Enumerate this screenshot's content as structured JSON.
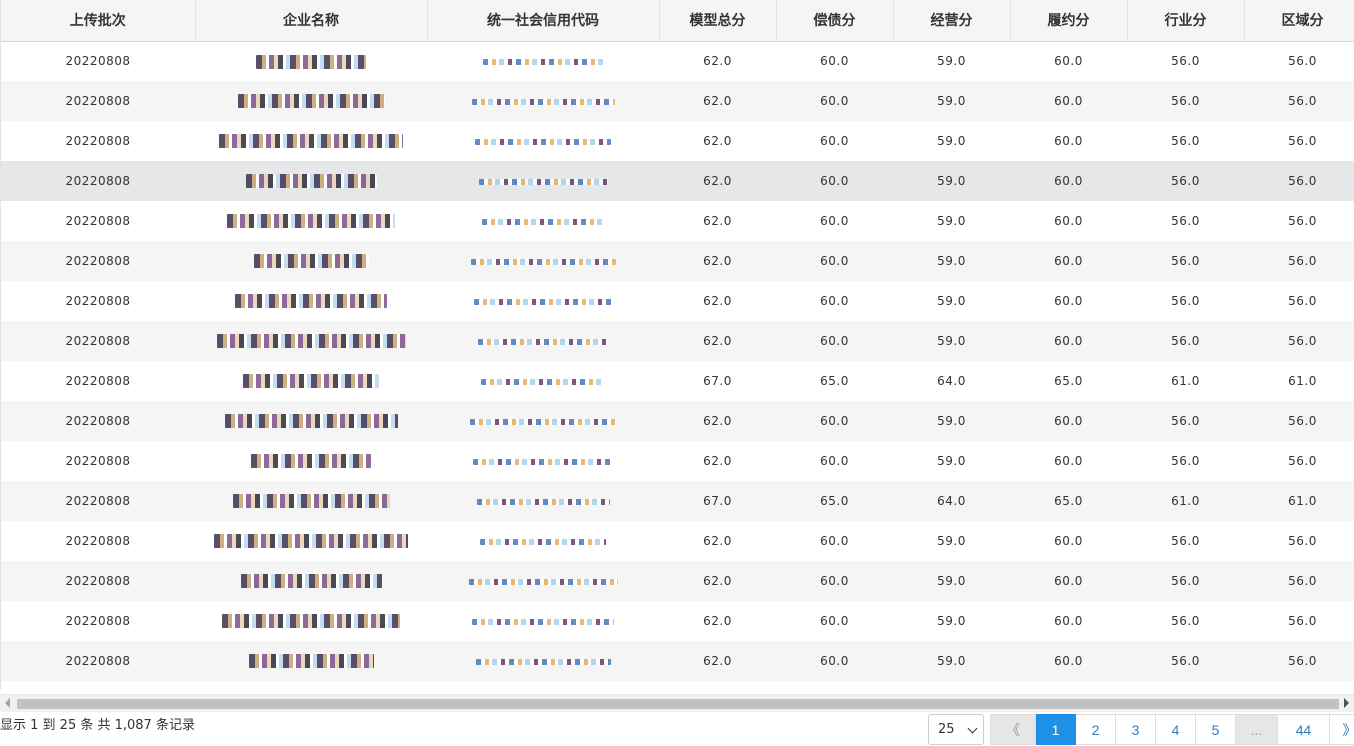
{
  "table": {
    "columns": [
      "上传批次",
      "企业名称",
      "统一社会信用代码",
      "模型总分",
      "偿债分",
      "经营分",
      "履约分",
      "行业分",
      "区域分"
    ],
    "rows": [
      {
        "batch": "20220808",
        "total": "62.0",
        "debt": "60.0",
        "operation": "59.0",
        "performance": "60.0",
        "industry": "56.0",
        "region": "56.0"
      },
      {
        "batch": "20220808",
        "total": "62.0",
        "debt": "60.0",
        "operation": "59.0",
        "performance": "60.0",
        "industry": "56.0",
        "region": "56.0"
      },
      {
        "batch": "20220808",
        "total": "62.0",
        "debt": "60.0",
        "operation": "59.0",
        "performance": "60.0",
        "industry": "56.0",
        "region": "56.0"
      },
      {
        "batch": "20220808",
        "total": "62.0",
        "debt": "60.0",
        "operation": "59.0",
        "performance": "60.0",
        "industry": "56.0",
        "region": "56.0"
      },
      {
        "batch": "20220808",
        "total": "62.0",
        "debt": "60.0",
        "operation": "59.0",
        "performance": "60.0",
        "industry": "56.0",
        "region": "56.0"
      },
      {
        "batch": "20220808",
        "total": "62.0",
        "debt": "60.0",
        "operation": "59.0",
        "performance": "60.0",
        "industry": "56.0",
        "region": "56.0"
      },
      {
        "batch": "20220808",
        "total": "62.0",
        "debt": "60.0",
        "operation": "59.0",
        "performance": "60.0",
        "industry": "56.0",
        "region": "56.0"
      },
      {
        "batch": "20220808",
        "total": "62.0",
        "debt": "60.0",
        "operation": "59.0",
        "performance": "60.0",
        "industry": "56.0",
        "region": "56.0"
      },
      {
        "batch": "20220808",
        "total": "67.0",
        "debt": "65.0",
        "operation": "64.0",
        "performance": "65.0",
        "industry": "61.0",
        "region": "61.0"
      },
      {
        "batch": "20220808",
        "total": "62.0",
        "debt": "60.0",
        "operation": "59.0",
        "performance": "60.0",
        "industry": "56.0",
        "region": "56.0"
      },
      {
        "batch": "20220808",
        "total": "62.0",
        "debt": "60.0",
        "operation": "59.0",
        "performance": "60.0",
        "industry": "56.0",
        "region": "56.0"
      },
      {
        "batch": "20220808",
        "total": "67.0",
        "debt": "65.0",
        "operation": "64.0",
        "performance": "65.0",
        "industry": "61.0",
        "region": "61.0"
      },
      {
        "batch": "20220808",
        "total": "62.0",
        "debt": "60.0",
        "operation": "59.0",
        "performance": "60.0",
        "industry": "56.0",
        "region": "56.0"
      },
      {
        "batch": "20220808",
        "total": "62.0",
        "debt": "60.0",
        "operation": "59.0",
        "performance": "60.0",
        "industry": "56.0",
        "region": "56.0"
      },
      {
        "batch": "20220808",
        "total": "62.0",
        "debt": "60.0",
        "operation": "59.0",
        "performance": "60.0",
        "industry": "56.0",
        "region": "56.0"
      },
      {
        "batch": "20220808",
        "total": "62.0",
        "debt": "60.0",
        "operation": "59.0",
        "performance": "60.0",
        "industry": "56.0",
        "region": "56.0"
      }
    ],
    "hovered_row": 4
  },
  "footer": {
    "info_text": "显示 1 到 25 条 共 1,087 条记录",
    "page_size": "25",
    "pages": [
      {
        "label": "《",
        "state": "disabled"
      },
      {
        "label": "1",
        "state": "active"
      },
      {
        "label": "2",
        "state": "normal"
      },
      {
        "label": "3",
        "state": "normal"
      },
      {
        "label": "4",
        "state": "normal"
      },
      {
        "label": "5",
        "state": "normal"
      },
      {
        "label": "...",
        "state": "disabled"
      },
      {
        "label": "44",
        "state": "normal"
      },
      {
        "label": "》",
        "state": "normal"
      }
    ]
  },
  "colors": {
    "header_bg": "#f5f5f5",
    "stripe_bg": "#f5f5f5",
    "hover_bg": "#e6e7e9",
    "active_page": "#1e90e6",
    "link": "#337ab7"
  }
}
